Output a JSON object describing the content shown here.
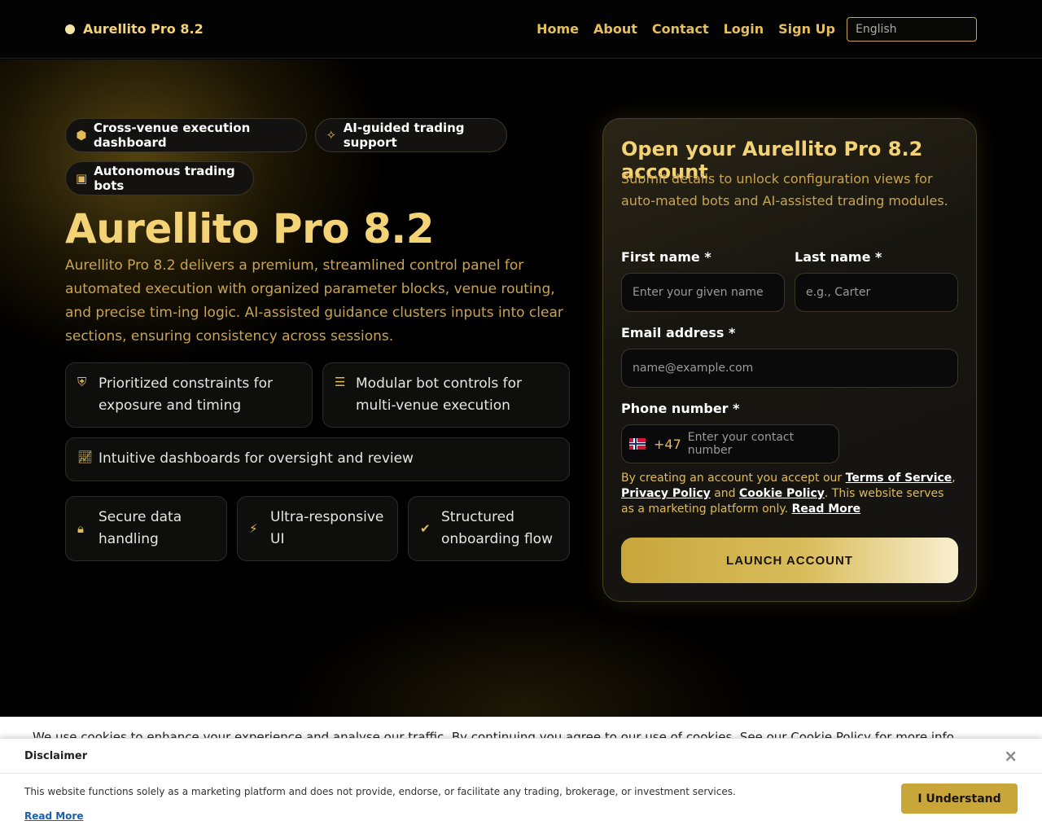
{
  "header": {
    "brand": "Aurellito Pro 8.2",
    "nav": [
      "Home",
      "About",
      "Contact",
      "Login",
      "Sign Up"
    ],
    "language": "English"
  },
  "hero": {
    "badges": [
      {
        "label": "Cross-venue execution dashboard",
        "icon": "cubes-icon"
      },
      {
        "label": "AI-guided trading support",
        "icon": "magic-wand-icon"
      },
      {
        "label": "Autonomous trading bots",
        "icon": "robot-icon"
      }
    ],
    "title": "Aurellito Pro 8.2",
    "description": "Aurellito Pro 8.2 delivers a premium, streamlined control panel for automated execution with organized parameter blocks, venue routing, and precise tim-ing logic. AI-assisted guidance clusters inputs into clear sections, ensuring consistency across sessions.",
    "features": [
      {
        "text": "Prioritized constraints for exposure and timing",
        "icon": "shield-icon"
      },
      {
        "text": "Modular bot controls for multi-venue execution",
        "icon": "sliders-icon"
      },
      {
        "text": "Intuitive dashboards for oversight and review",
        "icon": "line-chart-icon"
      },
      {
        "text": "Secure data handling",
        "icon": "lock-icon"
      },
      {
        "text": "Ultra-responsive UI",
        "icon": "lightning-icon"
      },
      {
        "text": "Structured onboarding flow",
        "icon": "check-circle-icon"
      }
    ]
  },
  "form": {
    "title": "Open your Aurellito Pro 8.2 account",
    "subtitle": "Submit details to unlock configuration views for auto-mated bots and AI-assisted trading modules.",
    "first_name_label": "First name *",
    "first_name_placeholder": "Enter your given name",
    "last_name_label": "Last name *",
    "last_name_placeholder": "e.g., Carter",
    "email_label": "Email address *",
    "email_placeholder": "name@example.com",
    "phone_label": "Phone number *",
    "phone_code": "+47",
    "phone_placeholder": "Enter your contact number",
    "terms_prefix": "By creating an account you accept our ",
    "terms_link": "Terms of Service",
    "terms_comma": ",",
    "privacy_link": "Privacy Policy",
    "and_text": " and ",
    "cookie_link": "Cookie Policy",
    "terms_suffix": ". This website serves as a marketing platform only. ",
    "read_more": "Read More",
    "submit": "LAUNCH ACCOUNT"
  },
  "cookie_strip": {
    "text": "We use cookies to enhance your experience and analyse our traffic. By continuing you agree to our use of cookies. See our Cookie Policy for more info."
  },
  "disclaimer": {
    "title": "Disclaimer",
    "close": "×",
    "text": "This website functions solely as a marketing platform and does not provide, endorse, or facilitate any trading, brokerage, or investment services.",
    "read_more": "Read More",
    "button": "I Understand"
  }
}
